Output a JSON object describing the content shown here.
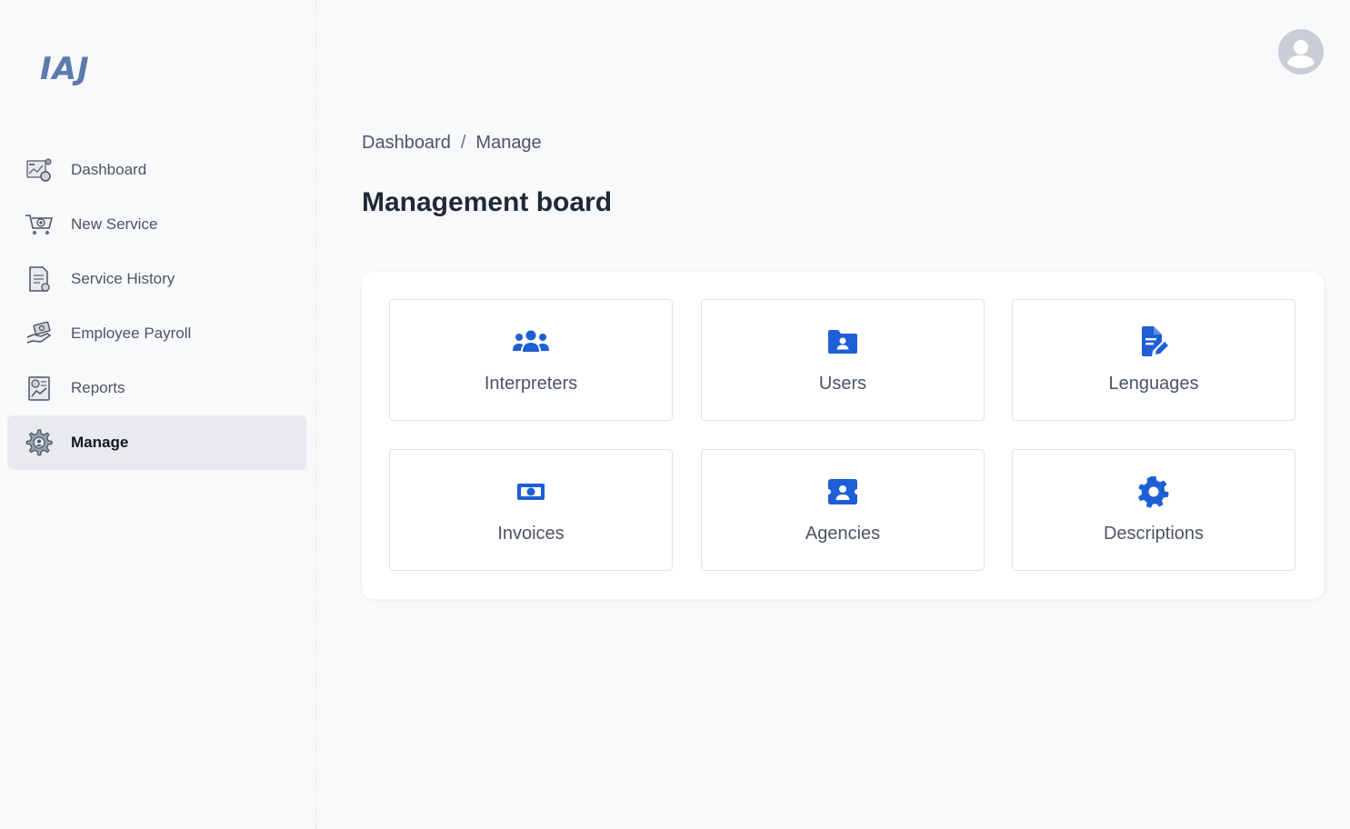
{
  "brand": {
    "logo_text": "IAJ",
    "logo_color": "#5b7bab"
  },
  "sidebar": {
    "items": [
      {
        "label": "Dashboard",
        "icon": "dashboard-icon",
        "active": false
      },
      {
        "label": "New Service",
        "icon": "cart-plus-icon",
        "active": false
      },
      {
        "label": "Service History",
        "icon": "document-list-icon",
        "active": false
      },
      {
        "label": "Employee Payroll",
        "icon": "hand-money-icon",
        "active": false
      },
      {
        "label": "Reports",
        "icon": "report-chart-icon",
        "active": false
      },
      {
        "label": "Manage",
        "icon": "gear-icon",
        "active": true
      }
    ]
  },
  "header": {
    "avatar_icon": "user-avatar-icon"
  },
  "breadcrumb": {
    "items": [
      "Dashboard",
      "Manage"
    ],
    "separator": "/"
  },
  "page": {
    "title": "Management board"
  },
  "board": {
    "accent_color": "#1f5fd6",
    "tiles": [
      {
        "label": "Interpreters",
        "icon": "users-group-icon"
      },
      {
        "label": "Users",
        "icon": "folder-user-icon"
      },
      {
        "label": "Lenguages",
        "icon": "file-pen-icon"
      },
      {
        "label": "Invoices",
        "icon": "money-bill-icon"
      },
      {
        "label": "Agencies",
        "icon": "id-badge-icon"
      },
      {
        "label": "Descriptions",
        "icon": "gear-icon"
      }
    ]
  }
}
